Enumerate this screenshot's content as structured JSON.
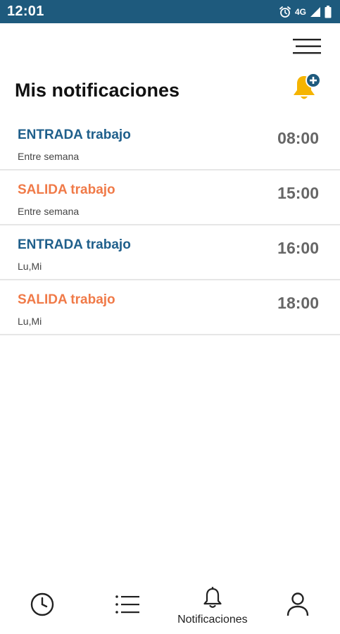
{
  "status_bar": {
    "time": "12:01",
    "network": "4G",
    "icons": [
      "alarm-icon",
      "signal-icon",
      "battery-icon"
    ]
  },
  "header": {
    "menu_icon": "hamburger-menu-icon",
    "title": "Mis notificaciones",
    "add_icon": "bell-plus-icon"
  },
  "notifications": [
    {
      "title": "ENTRADA trabajo",
      "type": "entrada",
      "days": "Entre semana",
      "time": "08:00"
    },
    {
      "title": "SALIDA trabajo",
      "type": "salida",
      "days": "Entre semana",
      "time": "15:00"
    },
    {
      "title": "ENTRADA trabajo",
      "type": "entrada",
      "days": "Lu,Mi",
      "time": "16:00"
    },
    {
      "title": "SALIDA trabajo",
      "type": "salida",
      "days": "Lu,Mi",
      "time": "18:00"
    }
  ],
  "bottom_nav": {
    "items": [
      {
        "icon": "clock-icon",
        "label": ""
      },
      {
        "icon": "list-icon",
        "label": ""
      },
      {
        "icon": "bell-icon",
        "label": "Notificaciones",
        "active": true
      },
      {
        "icon": "person-icon",
        "label": ""
      }
    ]
  },
  "colors": {
    "status_bar": "#1e5a7d",
    "entrada": "#1f5f8b",
    "salida": "#f07a48",
    "accent_bell": "#f5b400",
    "time_text": "#666666"
  }
}
